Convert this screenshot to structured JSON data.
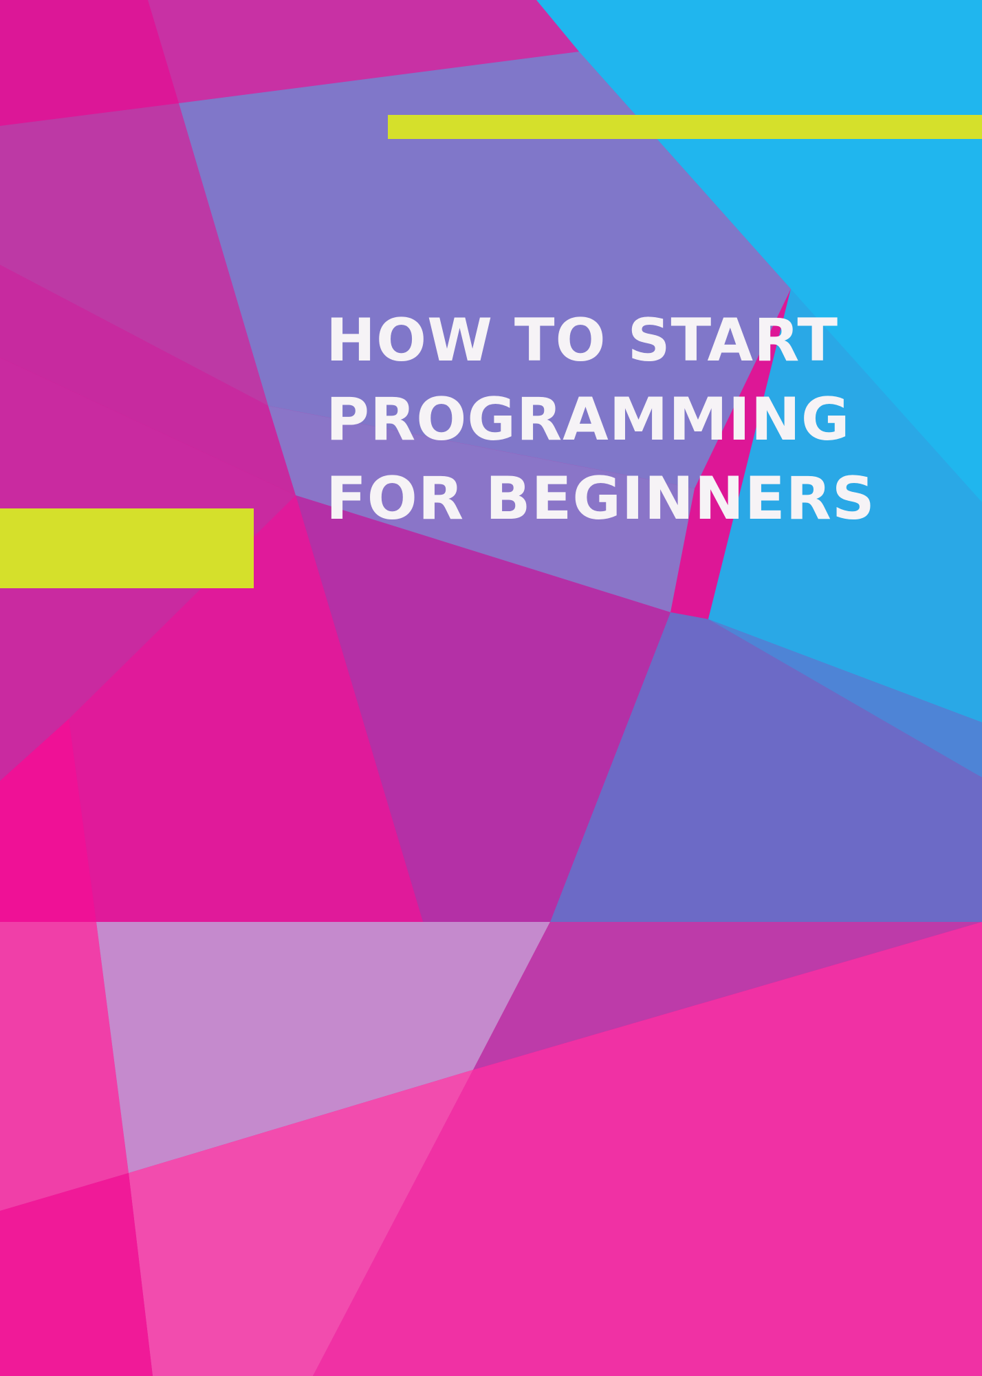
{
  "cover": {
    "title_lines": [
      "HOW TO START",
      "PROGRAMMING",
      "FOR BEGINNERS"
    ]
  },
  "colors": {
    "magenta": "#dd1796",
    "hot_pink": "#f0168f",
    "violet": "#8077c9",
    "sky_blue": "#20b6ee",
    "lilac": "#c48acd",
    "accent_lime": "#d5e02b",
    "title_text": "#f6f3f6"
  }
}
